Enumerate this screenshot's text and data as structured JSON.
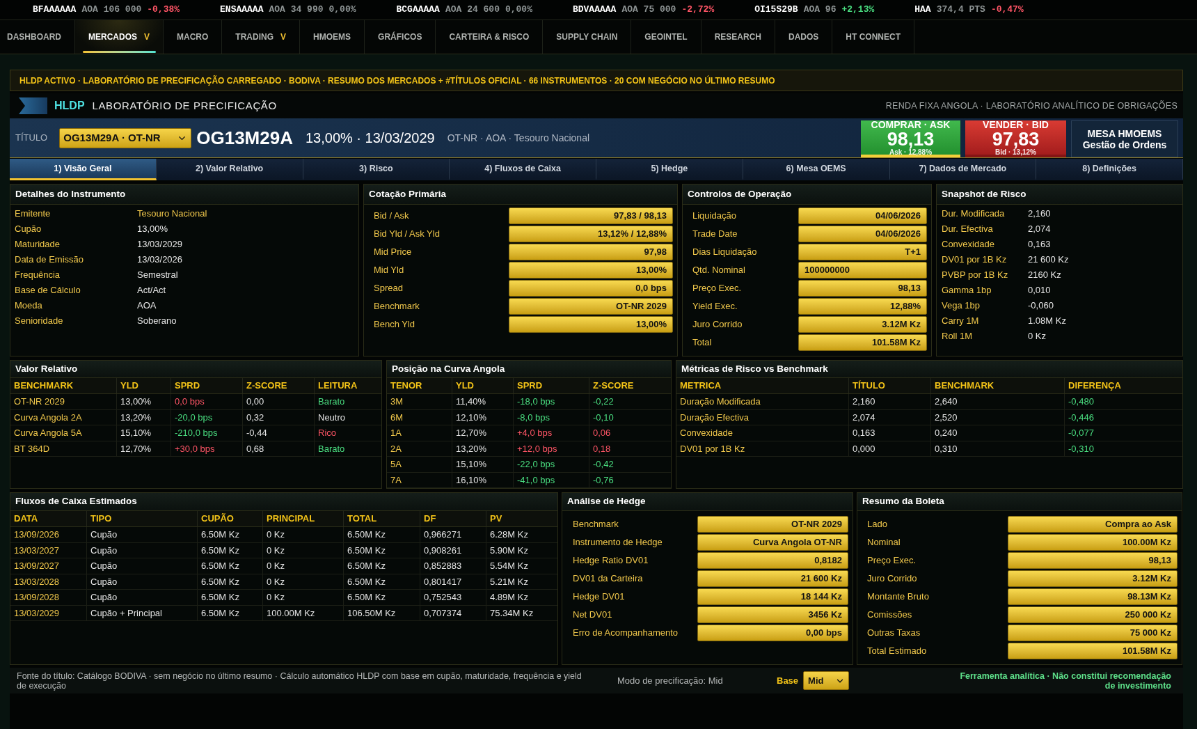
{
  "ticker": [
    {
      "symbol": "BFAAAAAA",
      "price": "AOA 106 000",
      "change": "-0,38%",
      "color": "#ff5566"
    },
    {
      "symbol": "ENSAAAAA",
      "price": "AOA 34 990",
      "change": "0,00%",
      "color": "#8f9696"
    },
    {
      "symbol": "BCGAAAAA",
      "price": "AOA 24 600",
      "change": "0,00%",
      "color": "#8f9696"
    },
    {
      "symbol": "BDVAAAAA",
      "price": "AOA 75 000",
      "change": "-2,72%",
      "color": "#ff5566"
    },
    {
      "symbol": "OI15S29B",
      "price": "AOA 96",
      "change": "+2,13%",
      "color": "#4ade80"
    },
    {
      "symbol": "HAA",
      "price": "374,4 PTS",
      "change": "-0,47%",
      "color": "#ff5566"
    }
  ],
  "nav": [
    {
      "label": "DASHBOARD",
      "selected": false
    },
    {
      "label": "MERCADOS",
      "caret": "V",
      "selected": true
    },
    {
      "label": "MACRO",
      "selected": false
    },
    {
      "label": "TRADING",
      "caret": "V",
      "selected": false
    },
    {
      "label": "HMOEMS",
      "selected": false
    },
    {
      "label": "GRÁFICOS",
      "selected": false
    },
    {
      "label": "CARTEIRA & RISCO",
      "selected": false
    },
    {
      "label": "SUPPLY CHAIN",
      "selected": false
    },
    {
      "label": "GEOINTEL",
      "selected": false
    },
    {
      "label": "RESEARCH",
      "selected": false
    },
    {
      "label": "DADOS",
      "selected": false
    },
    {
      "label": "HT CONNECT",
      "selected": false
    }
  ],
  "banner": "HLDP ACTIVO · LABORATÓRIO DE PRECIFICAÇÃO CARREGADO · BODIVA · RESUMO DOS MERCADOS + #TÍTULOS OFICIAL · 66 INSTRUMENTOS · 20 COM NEGÓCIO NO ÚLTIMO RESUMO",
  "header": {
    "brand": "HLDP",
    "title": "LABORATÓRIO DE PRECIFICAÇÃO",
    "subtitle": "RENDA FIXA ANGOLA · LABORATÓRIO ANALÍTICO DE OBRIGAÇÕES"
  },
  "instrument": {
    "label": "TÍTULO",
    "select": "OG13M29A · OT-NR",
    "code": "OG13M29A",
    "coupon_maturity": "13,00% · 13/03/2029",
    "meta": "OT-NR · AOA · Tesouro Nacional",
    "buy": {
      "label": "COMPRAR · ASK",
      "price": "98,13",
      "sub": "Ask · 12,88%",
      "selected": true
    },
    "sell": {
      "label": "VENDER · BID",
      "price": "97,83",
      "sub": "Bid · 13,12%",
      "selected": false
    },
    "desk": {
      "title": "MESA HMOEMS",
      "subtitle": "Gestão de Ordens"
    }
  },
  "tabs": [
    {
      "label": "1) Visão Geral",
      "selected": true
    },
    {
      "label": "2) Valor Relativo",
      "selected": false
    },
    {
      "label": "3) Risco",
      "selected": false
    },
    {
      "label": "4) Fluxos de Caixa",
      "selected": false
    },
    {
      "label": "5) Hedge",
      "selected": false
    },
    {
      "label": "6) Mesa OEMS",
      "selected": false
    },
    {
      "label": "7) Dados de Mercado",
      "selected": false
    },
    {
      "label": "8) Definições",
      "selected": false
    }
  ],
  "details": {
    "title": "Detalhes do Instrumento",
    "rows": [
      {
        "label": "Emitente",
        "value": "Tesouro Nacional",
        "emphasis": true
      },
      {
        "label": "Cupão",
        "value": "13,00%",
        "emphasis": false
      },
      {
        "label": "Maturidade",
        "value": "13/03/2029",
        "emphasis": false
      },
      {
        "label": "Data de Emissão",
        "value": "13/03/2026",
        "emphasis": false
      },
      {
        "label": "Frequência",
        "value": "Semestral",
        "emphasis": false
      },
      {
        "label": "Base de Cálculo",
        "value": "Act/Act",
        "emphasis": false
      },
      {
        "label": "Moeda",
        "value": "AOA",
        "emphasis": false
      },
      {
        "label": "Senioridade",
        "value": "Soberano",
        "emphasis": false
      }
    ]
  },
  "quote": {
    "title": "Cotação Primária",
    "rows": [
      {
        "label": "Bid / Ask",
        "value": "97,83 / 98,13"
      },
      {
        "label": "Bid Yld / Ask Yld",
        "value": "13,12% / 12,88%"
      },
      {
        "label": "Mid Price",
        "value": "97,98"
      },
      {
        "label": "Mid Yld",
        "value": "13,00%"
      },
      {
        "label": "Spread",
        "value": "0,0 bps"
      },
      {
        "label": "Benchmark",
        "value": "OT-NR 2029"
      },
      {
        "label": "Bench Yld",
        "value": "13,00%"
      }
    ]
  },
  "controls": {
    "title": "Controlos de Operação",
    "rows": [
      {
        "label": "Liquidação",
        "value": "04/06/2026",
        "kind": "readout"
      },
      {
        "label": "Trade Date",
        "value": "04/06/2026",
        "kind": "readout"
      },
      {
        "label": "Dias Liquidação",
        "value": "T+1",
        "kind": "readout"
      },
      {
        "label": "Qtd. Nominal",
        "value": "100000000",
        "kind": "input"
      },
      {
        "label": "Preço Exec.",
        "value": "98,13",
        "kind": "readout"
      },
      {
        "label": "Yield Exec.",
        "value": "12,88%",
        "kind": "readout"
      },
      {
        "label": "Juro Corrido",
        "value": "3.12M Kz",
        "kind": "readout"
      },
      {
        "label": "Total",
        "value": "101.58M Kz",
        "kind": "readout"
      }
    ]
  },
  "risk_snapshot": {
    "title": "Snapshot de Risco",
    "rows": [
      {
        "label": "Dur. Modificada",
        "value": "2,160"
      },
      {
        "label": "Dur. Efectiva",
        "value": "2,074"
      },
      {
        "label": "Convexidade",
        "value": "0,163"
      },
      {
        "label": "DV01 por 1B Kz",
        "value": "21 600 Kz"
      },
      {
        "label": "PVBP por 1B Kz",
        "value": "2160 Kz"
      },
      {
        "label": "Gamma 1bp",
        "value": "0,010"
      },
      {
        "label": "Vega 1bp",
        "value": "-0,060"
      },
      {
        "label": "Carry 1M",
        "value": "1.08M Kz"
      },
      {
        "label": "Roll 1M",
        "value": "0 Kz"
      }
    ]
  },
  "relative_value": {
    "title": "Valor Relativo",
    "columns": [
      "BENCHMARK",
      "YLD",
      "SPRD",
      "Z-SCORE",
      "LEITURA"
    ],
    "rows": [
      {
        "cells": [
          {
            "text": "OT-NR 2029",
            "color": "#f2c94c"
          },
          {
            "text": "13,00%",
            "color": "#e4e4e4"
          },
          {
            "text": "0,0 bps",
            "color": "#ff5566"
          },
          {
            "text": "0,00",
            "color": "#e4e4e4"
          },
          {
            "text": "Barato",
            "color": "#4ade80"
          }
        ]
      },
      {
        "cells": [
          {
            "text": "Curva Angola 2A",
            "color": "#f2c94c"
          },
          {
            "text": "13,20%",
            "color": "#e4e4e4"
          },
          {
            "text": "-20,0 bps",
            "color": "#4ade80"
          },
          {
            "text": "0,32",
            "color": "#e4e4e4"
          },
          {
            "text": "Neutro",
            "color": "#e4e4e4"
          }
        ]
      },
      {
        "cells": [
          {
            "text": "Curva Angola 5A",
            "color": "#f2c94c"
          },
          {
            "text": "15,10%",
            "color": "#e4e4e4"
          },
          {
            "text": "-210,0 bps",
            "color": "#4ade80"
          },
          {
            "text": "-0,44",
            "color": "#e4e4e4"
          },
          {
            "text": "Rico",
            "color": "#ff5566"
          }
        ]
      },
      {
        "cells": [
          {
            "text": "BT 364D",
            "color": "#f2c94c"
          },
          {
            "text": "12,70%",
            "color": "#e4e4e4"
          },
          {
            "text": "+30,0 bps",
            "color": "#ff5566"
          },
          {
            "text": "0,68",
            "color": "#e4e4e4"
          },
          {
            "text": "Barato",
            "color": "#4ade80"
          }
        ]
      }
    ]
  },
  "curve_position": {
    "title": "Posição na Curva Angola",
    "columns": [
      "TENOR",
      "YLD",
      "SPRD",
      "Z-SCORE"
    ],
    "rows": [
      {
        "cells": [
          {
            "text": "3M",
            "color": "#f2c94c"
          },
          {
            "text": "11,40%",
            "color": "#e4e4e4"
          },
          {
            "text": "-18,0 bps",
            "color": "#4ade80"
          },
          {
            "text": "-0,22",
            "color": "#4ade80"
          }
        ]
      },
      {
        "cells": [
          {
            "text": "6M",
            "color": "#f2c94c"
          },
          {
            "text": "12,10%",
            "color": "#e4e4e4"
          },
          {
            "text": "-8,0 bps",
            "color": "#4ade80"
          },
          {
            "text": "-0,10",
            "color": "#4ade80"
          }
        ]
      },
      {
        "cells": [
          {
            "text": "1A",
            "color": "#f2c94c"
          },
          {
            "text": "12,70%",
            "color": "#e4e4e4"
          },
          {
            "text": "+4,0 bps",
            "color": "#ff5566"
          },
          {
            "text": "0,06",
            "color": "#ff5566"
          }
        ]
      },
      {
        "cells": [
          {
            "text": "2A",
            "color": "#f2c94c"
          },
          {
            "text": "13,20%",
            "color": "#e4e4e4"
          },
          {
            "text": "+12,0 bps",
            "color": "#ff5566"
          },
          {
            "text": "0,18",
            "color": "#ff5566"
          }
        ]
      },
      {
        "cells": [
          {
            "text": "5A",
            "color": "#f2c94c"
          },
          {
            "text": "15,10%",
            "color": "#e4e4e4"
          },
          {
            "text": "-22,0 bps",
            "color": "#4ade80"
          },
          {
            "text": "-0,42",
            "color": "#4ade80"
          }
        ]
      },
      {
        "cells": [
          {
            "text": "7A",
            "color": "#f2c94c"
          },
          {
            "text": "16,10%",
            "color": "#e4e4e4"
          },
          {
            "text": "-41,0 bps",
            "color": "#4ade80"
          },
          {
            "text": "-0,76",
            "color": "#4ade80"
          }
        ]
      }
    ]
  },
  "risk_metrics": {
    "title": "Métricas de Risco vs Benchmark",
    "columns": [
      "METRICA",
      "TÍTULO",
      "BENCHMARK",
      "DIFERENÇA"
    ],
    "rows": [
      {
        "cells": [
          {
            "text": "Duração Modificada",
            "color": "#f2c94c"
          },
          {
            "text": "2,160",
            "color": "#e4e4e4"
          },
          {
            "text": "2,640",
            "color": "#e4e4e4"
          },
          {
            "text": "-0,480",
            "color": "#4ade80"
          }
        ]
      },
      {
        "cells": [
          {
            "text": "Duração Efectiva",
            "color": "#f2c94c"
          },
          {
            "text": "2,074",
            "color": "#e4e4e4"
          },
          {
            "text": "2,520",
            "color": "#e4e4e4"
          },
          {
            "text": "-0,446",
            "color": "#4ade80"
          }
        ]
      },
      {
        "cells": [
          {
            "text": "Convexidade",
            "color": "#f2c94c"
          },
          {
            "text": "0,163",
            "color": "#e4e4e4"
          },
          {
            "text": "0,240",
            "color": "#e4e4e4"
          },
          {
            "text": "-0,077",
            "color": "#4ade80"
          }
        ]
      },
      {
        "cells": [
          {
            "text": "DV01 por 1B Kz",
            "color": "#f2c94c"
          },
          {
            "text": "0,000",
            "color": "#e4e4e4"
          },
          {
            "text": "0,310",
            "color": "#e4e4e4"
          },
          {
            "text": "-0,310",
            "color": "#4ade80"
          }
        ]
      }
    ]
  },
  "cash_flows": {
    "title": "Fluxos de Caixa Estimados",
    "columns": [
      "DATA",
      "TIPO",
      "CUPÃO",
      "PRINCIPAL",
      "TOTAL",
      "DF",
      "PV"
    ],
    "rows": [
      {
        "cells": [
          {
            "text": "13/09/2026",
            "color": "#f2c94c"
          },
          {
            "text": "Cupão",
            "color": "#e4e4e4"
          },
          {
            "text": "6.50M Kz",
            "color": "#e4e4e4"
          },
          {
            "text": "0 Kz",
            "color": "#e4e4e4"
          },
          {
            "text": "6.50M Kz",
            "color": "#e4e4e4"
          },
          {
            "text": "0,966271",
            "color": "#e4e4e4"
          },
          {
            "text": "6.28M Kz",
            "color": "#e4e4e4"
          }
        ]
      },
      {
        "cells": [
          {
            "text": "13/03/2027",
            "color": "#f2c94c"
          },
          {
            "text": "Cupão",
            "color": "#e4e4e4"
          },
          {
            "text": "6.50M Kz",
            "color": "#e4e4e4"
          },
          {
            "text": "0 Kz",
            "color": "#e4e4e4"
          },
          {
            "text": "6.50M Kz",
            "color": "#e4e4e4"
          },
          {
            "text": "0,908261",
            "color": "#e4e4e4"
          },
          {
            "text": "5.90M Kz",
            "color": "#e4e4e4"
          }
        ]
      },
      {
        "cells": [
          {
            "text": "13/09/2027",
            "color": "#f2c94c"
          },
          {
            "text": "Cupão",
            "color": "#e4e4e4"
          },
          {
            "text": "6.50M Kz",
            "color": "#e4e4e4"
          },
          {
            "text": "0 Kz",
            "color": "#e4e4e4"
          },
          {
            "text": "6.50M Kz",
            "color": "#e4e4e4"
          },
          {
            "text": "0,852883",
            "color": "#e4e4e4"
          },
          {
            "text": "5.54M Kz",
            "color": "#e4e4e4"
          }
        ]
      },
      {
        "cells": [
          {
            "text": "13/03/2028",
            "color": "#f2c94c"
          },
          {
            "text": "Cupão",
            "color": "#e4e4e4"
          },
          {
            "text": "6.50M Kz",
            "color": "#e4e4e4"
          },
          {
            "text": "0 Kz",
            "color": "#e4e4e4"
          },
          {
            "text": "6.50M Kz",
            "color": "#e4e4e4"
          },
          {
            "text": "0,801417",
            "color": "#e4e4e4"
          },
          {
            "text": "5.21M Kz",
            "color": "#e4e4e4"
          }
        ]
      },
      {
        "cells": [
          {
            "text": "13/09/2028",
            "color": "#f2c94c"
          },
          {
            "text": "Cupão",
            "color": "#e4e4e4"
          },
          {
            "text": "6.50M Kz",
            "color": "#e4e4e4"
          },
          {
            "text": "0 Kz",
            "color": "#e4e4e4"
          },
          {
            "text": "6.50M Kz",
            "color": "#e4e4e4"
          },
          {
            "text": "0,752543",
            "color": "#e4e4e4"
          },
          {
            "text": "4.89M Kz",
            "color": "#e4e4e4"
          }
        ]
      },
      {
        "cells": [
          {
            "text": "13/03/2029",
            "color": "#f2c94c"
          },
          {
            "text": "Cupão + Principal",
            "color": "#e4e4e4"
          },
          {
            "text": "6.50M Kz",
            "color": "#e4e4e4"
          },
          {
            "text": "100.00M Kz",
            "color": "#e4e4e4"
          },
          {
            "text": "106.50M Kz",
            "color": "#e4e4e4"
          },
          {
            "text": "0,707374",
            "color": "#e4e4e4"
          },
          {
            "text": "75.34M Kz",
            "color": "#e4e4e4"
          }
        ]
      }
    ]
  },
  "hedge": {
    "title": "Análise de Hedge",
    "rows": [
      {
        "label": "Benchmark",
        "value": "OT-NR 2029"
      },
      {
        "label": "Instrumento de Hedge",
        "value": "Curva Angola OT-NR"
      },
      {
        "label": "Hedge Ratio DV01",
        "value": "0,8182"
      },
      {
        "label": "DV01 da Carteira",
        "value": "21 600 Kz"
      },
      {
        "label": "Hedge DV01",
        "value": "18 144 Kz"
      },
      {
        "label": "Net DV01",
        "value": "3456 Kz"
      },
      {
        "label": "Erro de Acompanhamento",
        "value": "0,00 bps"
      }
    ]
  },
  "ticket": {
    "title": "Resumo da Boleta",
    "rows": [
      {
        "label": "Lado",
        "value": "Compra ao Ask"
      },
      {
        "label": "Nominal",
        "value": "100.00M Kz"
      },
      {
        "label": "Preço Exec.",
        "value": "98,13"
      },
      {
        "label": "Juro Corrido",
        "value": "3.12M Kz"
      },
      {
        "label": "Montante Bruto",
        "value": "98.13M Kz"
      },
      {
        "label": "Comissões",
        "value": "250 000 Kz"
      },
      {
        "label": "Outras Taxas",
        "value": "75 000 Kz"
      },
      {
        "label": "Total Estimado",
        "value": "101.58M Kz"
      }
    ]
  },
  "footer": {
    "note": "Fonte do título: Catálogo BODIVA · sem negócio no último resumo · Cálculo automático HLDP com base em cupão, maturidade, frequência e yield de execução",
    "pricing_mode": "Modo de precificação: Mid",
    "base_label": "Base",
    "base_value": "Mid",
    "disclaimer": "Ferramenta analítica · Não constitui recomendação de investimento"
  }
}
